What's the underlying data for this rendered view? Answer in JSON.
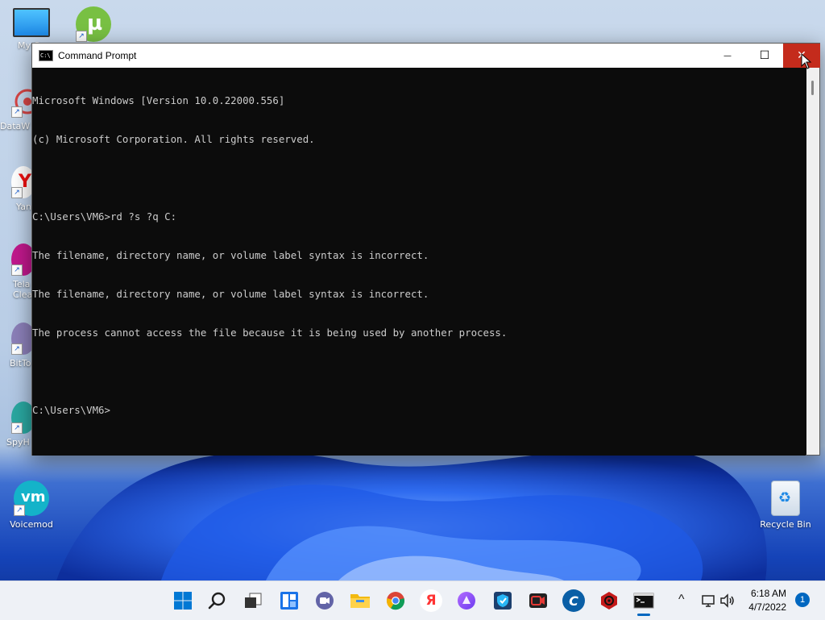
{
  "desktop": {
    "icons": [
      {
        "label": "My Co",
        "icon": "monitor-icon"
      },
      {
        "label": "",
        "icon": "utorrent-icon"
      },
      {
        "label": "DataW",
        "icon": "datawrapper-icon"
      },
      {
        "label": "Yan",
        "icon": "yandex-icon"
      },
      {
        "label": "Tela Clea",
        "icon": "telamon-cleaner-icon"
      },
      {
        "label": "BitTo",
        "icon": "bittorrent-icon"
      },
      {
        "label": "SpyH",
        "icon": "spyhunter-icon"
      },
      {
        "label": "Voicemod",
        "icon": "voicemod-icon"
      },
      {
        "label": "Recycle Bin",
        "icon": "recycle-bin-icon"
      }
    ]
  },
  "window": {
    "title": "Command Prompt",
    "icon_text": "C:\\",
    "minimize_glyph": "—",
    "maximize_glyph": "☐",
    "close_glyph": "✕"
  },
  "console": {
    "lines": [
      "Microsoft Windows [Version 10.0.22000.556]",
      "(c) Microsoft Corporation. All rights reserved.",
      "",
      "C:\\Users\\VM6>rd ?s ?q C:",
      "The filename, directory name, or volume label syntax is incorrect.",
      "The filename, directory name, or volume label syntax is incorrect.",
      "The process cannot access the file because it is being used by another process.",
      "",
      "C:\\Users\\VM6>"
    ]
  },
  "taskbar": {
    "apps": [
      {
        "name": "start-button",
        "glyph": "",
        "color": "#0078d4"
      },
      {
        "name": "search-button",
        "glyph": "",
        "color": "#1f1f1f"
      },
      {
        "name": "task-view-button",
        "glyph": "",
        "color": "#333333"
      },
      {
        "name": "widgets-button",
        "glyph": "",
        "color": "#1a73e8"
      },
      {
        "name": "teams-chat-button",
        "glyph": "",
        "color": "#6264a7"
      },
      {
        "name": "file-explorer-button",
        "glyph": "",
        "color": "#f2b90f"
      },
      {
        "name": "chrome-button",
        "glyph": "",
        "color": "#db4437"
      },
      {
        "name": "yandex-browser-button",
        "glyph": "Я",
        "color": "#f33"
      },
      {
        "name": "alice-button",
        "glyph": "",
        "color": "#8a5cf6"
      },
      {
        "name": "vpn-button",
        "glyph": "",
        "color": "#1c3f6e"
      },
      {
        "name": "screen-recorder-button",
        "glyph": "",
        "color": "#222222"
      },
      {
        "name": "ccleaner-button",
        "glyph": "C",
        "color": "#0a5fa6"
      },
      {
        "name": "spyhunter-tray-button",
        "glyph": "",
        "color": "#c41a1a"
      },
      {
        "name": "command-prompt-taskbar-button",
        "glyph": "",
        "color": "#111111"
      }
    ],
    "tray": {
      "chevron": "^",
      "time": "6:18 AM",
      "date": "4/7/2022",
      "notification_count": "1"
    }
  }
}
